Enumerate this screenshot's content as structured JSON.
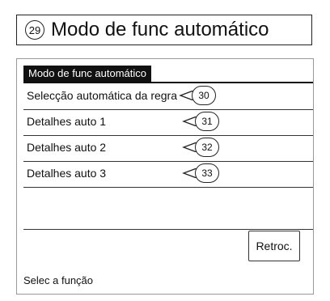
{
  "title": {
    "number": "29",
    "text": "Modo de func automático"
  },
  "panel": {
    "header": "Modo de func automático"
  },
  "rows": [
    {
      "label": "Selecção automática da regra",
      "callout": "30"
    },
    {
      "label": "Detalhes auto 1",
      "callout": "31"
    },
    {
      "label": "Detalhes auto 2",
      "callout": "32"
    },
    {
      "label": "Detalhes auto 3",
      "callout": "33"
    },
    {
      "label": ""
    }
  ],
  "buttons": {
    "back": "Retroc."
  },
  "status": "Selec a função"
}
